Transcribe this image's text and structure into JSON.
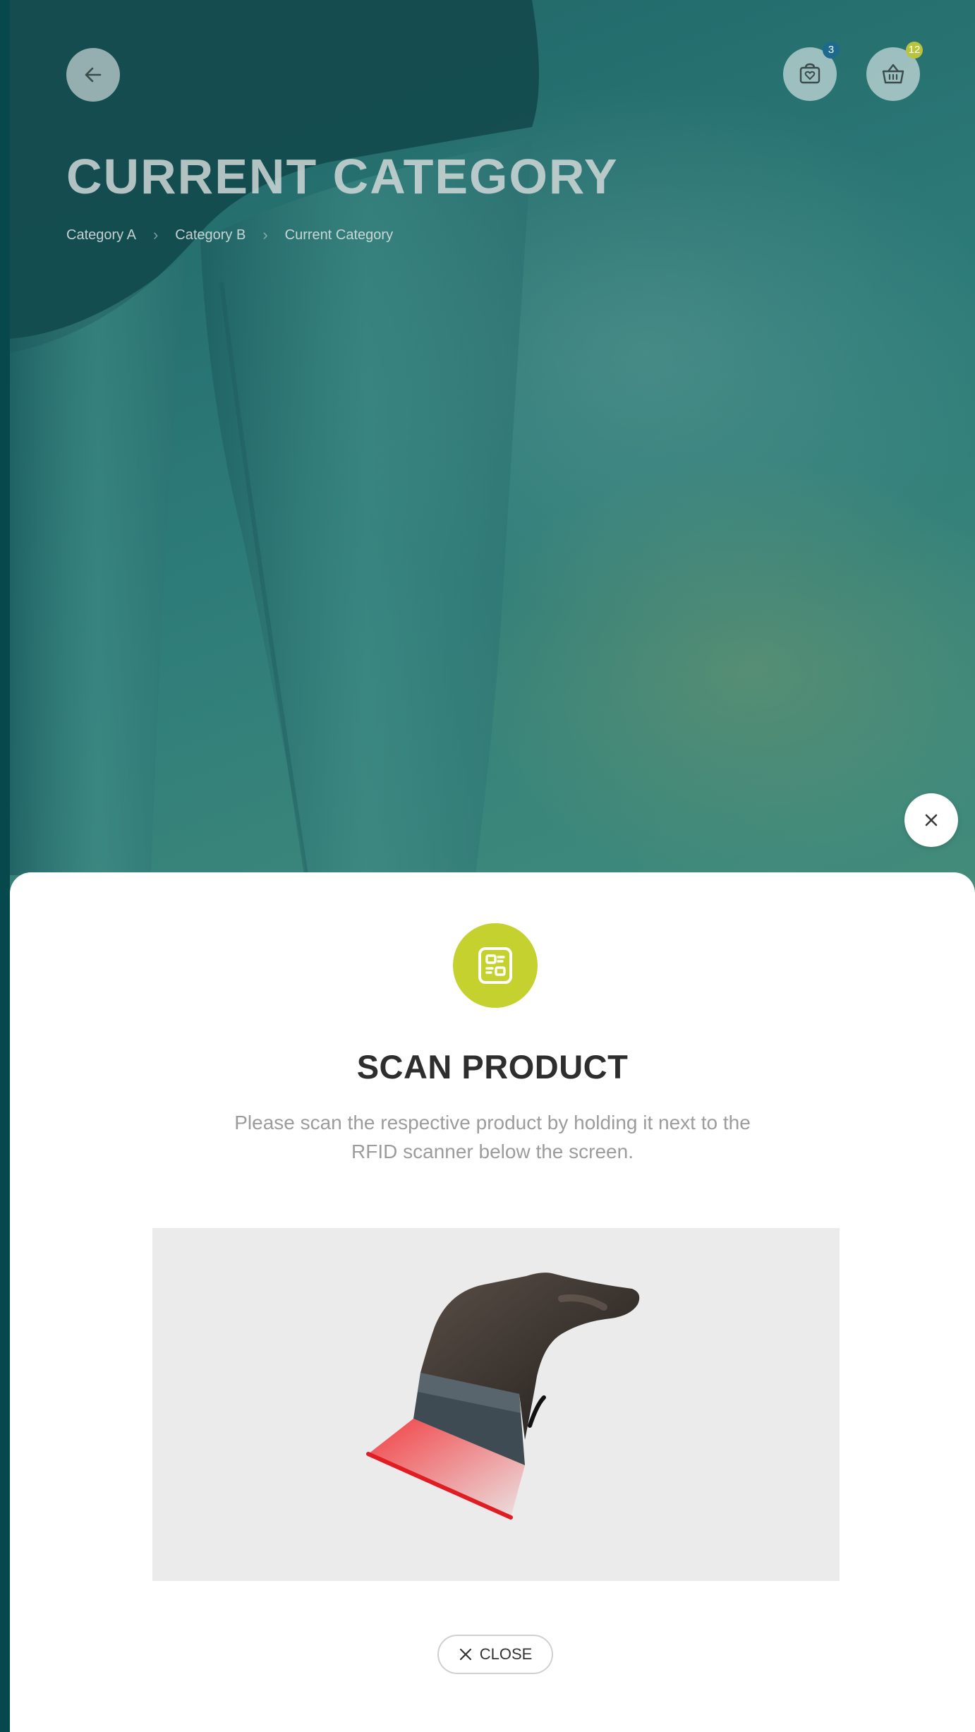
{
  "header": {
    "title": "CURRENT CATEGORY",
    "breadcrumb": [
      "Category A",
      "Category B",
      "Current Category"
    ],
    "wishlist_count": "3",
    "basket_count": "12"
  },
  "modal": {
    "title": "SCAN PRODUCT",
    "description": "Please scan the respective product by holding it next to the RFID scanner below the screen.",
    "close_label": "CLOSE"
  },
  "colors": {
    "accent_lime": "#c4d12e",
    "background_teal": "#2d7b79",
    "scan_beam_red": "#e8262c"
  },
  "icons": {
    "back": "arrow-left-icon",
    "wishlist": "shopping-bag-heart-icon",
    "basket": "basket-icon",
    "dismiss": "close-icon",
    "scan": "qr-scan-icon"
  }
}
